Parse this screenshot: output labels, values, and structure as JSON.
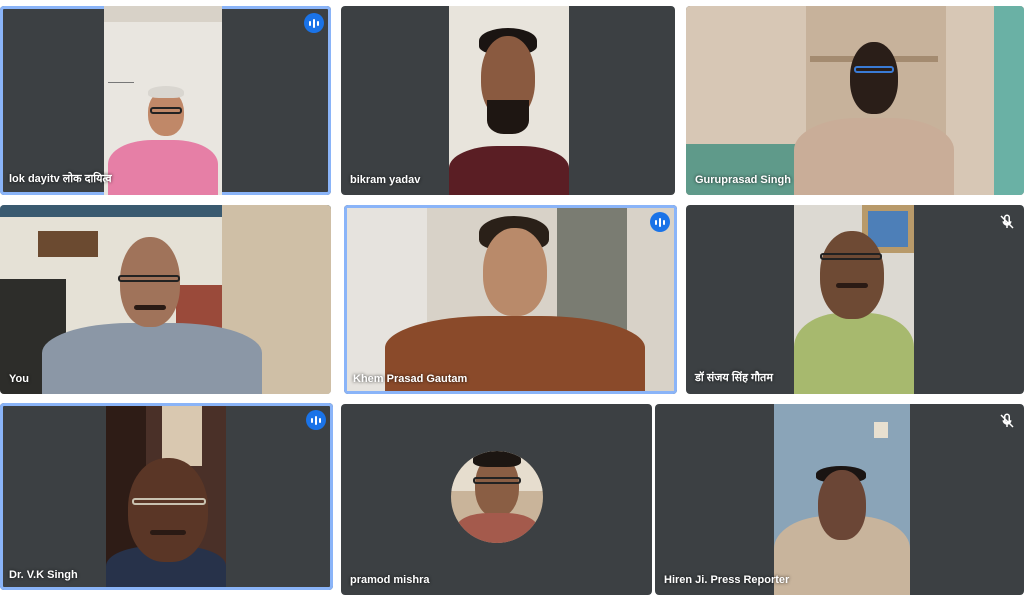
{
  "participants": [
    {
      "name": "lok dayitv लोक दायित्व",
      "speaking": true,
      "muted": false
    },
    {
      "name": "bikram yadav",
      "speaking": false,
      "muted": false
    },
    {
      "name": "Guruprasad Singh",
      "speaking": false,
      "muted": false
    },
    {
      "name": "You",
      "speaking": false,
      "muted": false
    },
    {
      "name": "Khem Prasad Gautam",
      "speaking": true,
      "muted": false
    },
    {
      "name": "डॉ संजय सिंह गौतम",
      "speaking": false,
      "muted": true
    },
    {
      "name": "Dr. V.K Singh",
      "speaking": true,
      "muted": false
    },
    {
      "name": "pramod mishra",
      "speaking": false,
      "muted": false
    },
    {
      "name": "Hiren Ji. Press Reporter",
      "speaking": false,
      "muted": true
    }
  ],
  "icons": {
    "speaking": "audio-level-icon",
    "muted": "mic-off-icon"
  },
  "colors": {
    "tile_bg": "#3c4043",
    "active_border": "#8ab4f8",
    "audio_badge": "#1a73e8"
  }
}
